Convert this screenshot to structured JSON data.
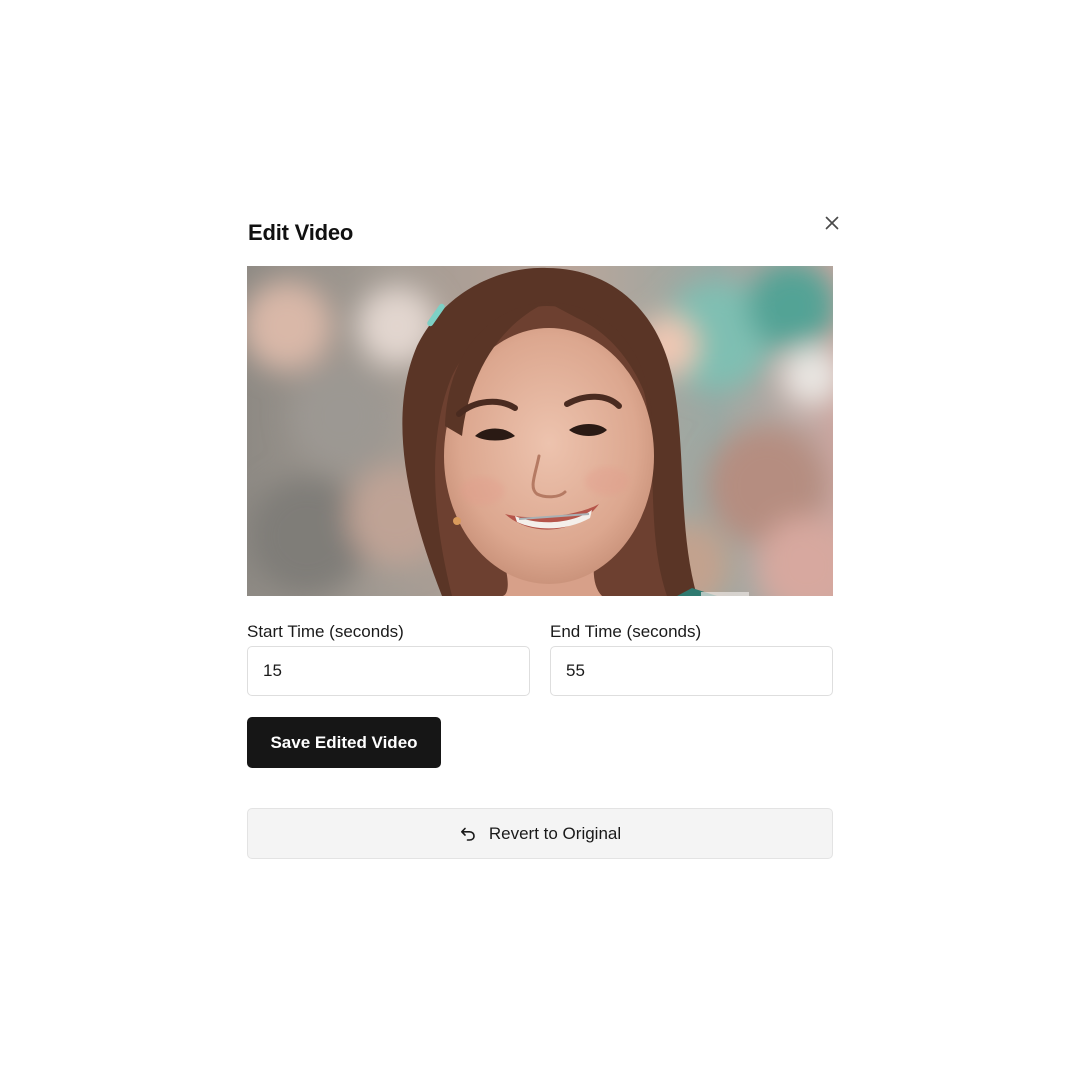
{
  "dialog": {
    "title": "Edit Video",
    "close_icon": "close-icon"
  },
  "video": {
    "alt": "Video frame: smiling woman with braces, blurred street background"
  },
  "start_time": {
    "label": "Start Time (seconds)",
    "value": "15"
  },
  "end_time": {
    "label": "End Time (seconds)",
    "value": "55"
  },
  "actions": {
    "save_label": "Save Edited Video",
    "revert_label": "Revert to Original",
    "revert_icon": "undo-icon"
  },
  "colors": {
    "primary_button": "#161616",
    "secondary_button": "#f4f4f4",
    "border": "#dedede"
  }
}
